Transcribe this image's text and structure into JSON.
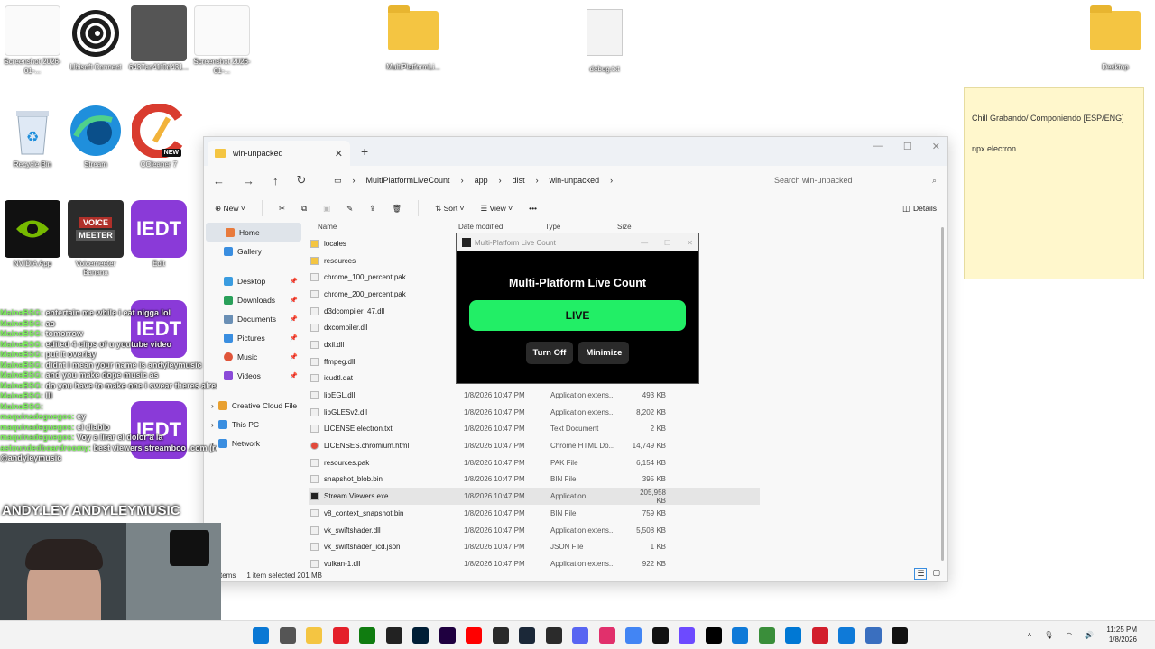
{
  "desktop": {
    "icons": [
      {
        "label": "Screenshot 2026-01-...",
        "color": "#eeeeee"
      },
      {
        "label": "Ubisoft Connect",
        "color": "#ffffff"
      },
      {
        "label": "6437ac41f0d431...",
        "color": "#555555"
      },
      {
        "label": "Screenshot 2026-01-...",
        "color": "#eeeeee"
      },
      {
        "label": "MultiPlatformLi...",
        "color": "#f4c542"
      },
      {
        "label": "debug.txt",
        "color": "#f3f3f3"
      },
      {
        "label": "Desktop",
        "color": "#f4c542"
      },
      {
        "label": "Recycle Bin",
        "color": "#dfe9f5"
      },
      {
        "label": "Stream",
        "color": "#1f8fdc"
      },
      {
        "label": "CCleaner 7",
        "color": "#d93c2f"
      },
      {
        "label": "NVIDIA App",
        "color": "#76b900"
      },
      {
        "label": "Voicemeeter Banana",
        "color": "#b0302a"
      },
      {
        "label": "Edit",
        "color": "#8a3ad8"
      }
    ],
    "icon_texts": {
      "voice": "VOICE",
      "meeter": "MEETER",
      "iedt": "IEDT",
      "new": "NEW"
    }
  },
  "sticky": {
    "line1": "Chill Grabando/ Componiendo [ESP/ENG]",
    "line2": "npx electron ."
  },
  "explorer": {
    "tab_title": "win-unpacked",
    "breadcrumb": [
      "MultiPlatformLiveCount",
      "app",
      "dist",
      "win-unpacked"
    ],
    "search_placeholder": "Search win-unpacked",
    "toolbar": {
      "new": "New",
      "sort": "Sort",
      "view": "View",
      "more": "•••",
      "details": "Details"
    },
    "sidebar": {
      "home": "Home",
      "gallery": "Gallery",
      "desktop": "Desktop",
      "downloads": "Downloads",
      "documents": "Documents",
      "pictures": "Pictures",
      "music": "Music",
      "videos": "Videos",
      "creative_cloud": "Creative Cloud File",
      "this_pc": "This PC",
      "network": "Network"
    },
    "columns": {
      "name": "Name",
      "date": "Date modified",
      "type": "Type",
      "size": "Size"
    },
    "files": [
      {
        "name": "locales",
        "date": "",
        "type": "",
        "size": "",
        "kind": "folder"
      },
      {
        "name": "resources",
        "date": "",
        "type": "",
        "size": "",
        "kind": "folder"
      },
      {
        "name": "chrome_100_percent.pak",
        "date": "",
        "type": "",
        "size": "",
        "kind": "file"
      },
      {
        "name": "chrome_200_percent.pak",
        "date": "",
        "type": "",
        "size": "",
        "kind": "file"
      },
      {
        "name": "d3dcompiler_47.dll",
        "date": "",
        "type": "",
        "size": "",
        "kind": "file"
      },
      {
        "name": "dxcompiler.dll",
        "date": "",
        "type": "",
        "size": "",
        "kind": "file"
      },
      {
        "name": "dxil.dll",
        "date": "",
        "type": "",
        "size": "",
        "kind": "file"
      },
      {
        "name": "ffmpeg.dll",
        "date": "",
        "type": "",
        "size": "",
        "kind": "file"
      },
      {
        "name": "icudtl.dat",
        "date": "",
        "type": "",
        "size": "",
        "kind": "file"
      },
      {
        "name": "libEGL.dll",
        "date": "1/8/2026 10:47 PM",
        "type": "Application extens...",
        "size": "493 KB",
        "kind": "file"
      },
      {
        "name": "libGLESv2.dll",
        "date": "1/8/2026 10:47 PM",
        "type": "Application extens...",
        "size": "8,202 KB",
        "kind": "file"
      },
      {
        "name": "LICENSE.electron.txt",
        "date": "1/8/2026 10:47 PM",
        "type": "Text Document",
        "size": "2 KB",
        "kind": "file"
      },
      {
        "name": "LICENSES.chromium.html",
        "date": "1/8/2026 10:47 PM",
        "type": "Chrome HTML Do...",
        "size": "14,749 KB",
        "kind": "chrome"
      },
      {
        "name": "resources.pak",
        "date": "1/8/2026 10:47 PM",
        "type": "PAK File",
        "size": "6,154 KB",
        "kind": "file"
      },
      {
        "name": "snapshot_blob.bin",
        "date": "1/8/2026 10:47 PM",
        "type": "BIN File",
        "size": "395 KB",
        "kind": "file"
      },
      {
        "name": "Stream Viewers.exe",
        "date": "1/8/2026 10:47 PM",
        "type": "Application",
        "size": "205,958 KB",
        "kind": "exe",
        "selected": true
      },
      {
        "name": "v8_context_snapshot.bin",
        "date": "1/8/2026 10:47 PM",
        "type": "BIN File",
        "size": "759 KB",
        "kind": "file"
      },
      {
        "name": "vk_swiftshader.dll",
        "date": "1/8/2026 10:47 PM",
        "type": "Application extens...",
        "size": "5,508 KB",
        "kind": "file"
      },
      {
        "name": "vk_swiftshader_icd.json",
        "date": "1/8/2026 10:47 PM",
        "type": "JSON File",
        "size": "1 KB",
        "kind": "file"
      },
      {
        "name": "vulkan-1.dll",
        "date": "1/8/2026 10:47 PM",
        "type": "Application extens...",
        "size": "922 KB",
        "kind": "file"
      }
    ],
    "status": {
      "items": "tems",
      "selected": "1 item selected  201 MB"
    }
  },
  "popup": {
    "window_title": "Multi-Platform Live Count",
    "heading": "Multi-Platform Live Count",
    "live_label": "LIVE",
    "turn_off_label": "Turn Off",
    "minimize_label": "Minimize",
    "live_color": "#22ee66"
  },
  "chat": [
    {
      "user": "MaineBSG:",
      "msg": " entertain me while i eat nigga lol"
    },
    {
      "user": "MaineBSG:",
      "msg": " ao"
    },
    {
      "user": "MaineBSG:",
      "msg": " tomorrow"
    },
    {
      "user": "MaineBSG:",
      "msg": " edited 4 clips of u youtube video"
    },
    {
      "user": "MaineBSG:",
      "msg": " put it overlay"
    },
    {
      "user": "MaineBSG:",
      "msg": " didnt i mean your name is andyleymusic"
    },
    {
      "user": "MaineBSG:",
      "msg": " and you make dope music as"
    },
    {
      "user": "MaineBSG:",
      "msg": " do you have to make one i swear theres already one out there"
    },
    {
      "user": "MaineBSG:",
      "msg": " Ill"
    },
    {
      "user": "MaineBSG:",
      "msg": ""
    },
    {
      "user": "maquinadeguegos:",
      "msg": " ey"
    },
    {
      "user": "maquinadeguegos:",
      "msg": " el diablo"
    },
    {
      "user": "maquinadeguegos:",
      "msg": " Voy a lirar el dolor a la"
    },
    {
      "user": "astoundedboardroomy:",
      "msg": " best viewers streamboo .com (remove the space)"
    },
    {
      "user": "",
      "msg": "@andyleymusic"
    }
  ],
  "overlay_handle": "ANDY.LEY  ANDYLEYMUSIC",
  "taskbar": {
    "icons": [
      "windows-start",
      "file-manager",
      "folder",
      "opera",
      "xbox",
      "unity",
      "photoshop",
      "premiere",
      "youtube",
      "epic",
      "steam",
      "obs",
      "discord",
      "instagram",
      "chrome",
      "tiktok",
      "proton",
      "capcut",
      "edge",
      "minecraft",
      "photos",
      "capcut-red",
      "edge-alt",
      "notepad",
      "app"
    ],
    "icon_colors": [
      "#0a78d4",
      "#555555",
      "#f4c542",
      "#e4202a",
      "#107c10",
      "#222222",
      "#001e36",
      "#1f0040",
      "#ff0000",
      "#2a2a2a",
      "#1b2838",
      "#2b2b2b",
      "#5865f2",
      "#e1306c",
      "#4285f4",
      "#111111",
      "#6d4aff",
      "#000000",
      "#0f7ad8",
      "#3a8e3a",
      "#0078d4",
      "#d21e2c",
      "#0f7ad8",
      "#3a6fbf",
      "#111111"
    ],
    "time": "11:25 PM",
    "date": "1/8/2026"
  }
}
